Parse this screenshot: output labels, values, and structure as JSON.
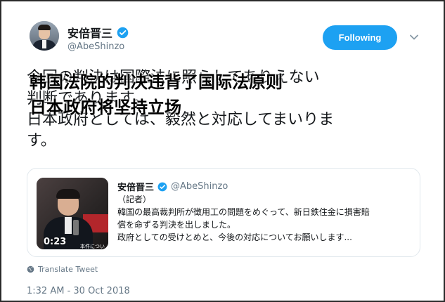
{
  "tweet": {
    "author": {
      "display_name": "安倍晋三",
      "handle": "@AbeShinzo",
      "verified": true
    },
    "follow_button": "Following",
    "text_lines": [
      "今回の判決は国際法に照らしてありえない",
      "判断であります。",
      "日本政府としては、毅然と対応してまいりま",
      "す。"
    ],
    "overlay_lines": [
      "韩国法院的判决违背了国际法原则",
      "日本政府将坚持立场"
    ],
    "translate_label": "Translate Tweet",
    "timestamp": "1:32 AM - 30 Oct 2018"
  },
  "quoted": {
    "display_name": "安倍晋三",
    "handle": "@AbeShinzo",
    "verified": true,
    "video_duration": "0:23",
    "video_caption": "本件についての",
    "body_lines": [
      "（記者）",
      "韓国の最高裁判所が徴用工の問題をめぐって、新日鉄住金に損害賠",
      "償を命ずる判決を出しました。",
      "政府としての受けとめと、今後の対応についてお願いします..."
    ]
  },
  "colors": {
    "accent": "#1da1f2",
    "muted": "#657786",
    "text": "#14171a"
  },
  "icons": {
    "verified": "verified-badge-icon",
    "caret": "chevron-down-icon",
    "globe": "globe-icon"
  }
}
